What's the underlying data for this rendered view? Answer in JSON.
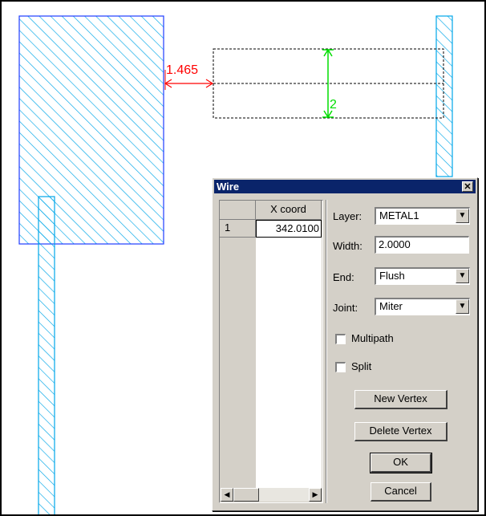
{
  "colors": {
    "shape_hatch": "#00a6e8",
    "shape_edge": "#1e3cff",
    "dimension_red": "#ff0000",
    "dimension_green": "#00dd00",
    "dialog_face": "#d4d0c8",
    "title_active": "#0a246a"
  },
  "canvas": {
    "dimension_horizontal": "1.465",
    "dimension_vertical": "2"
  },
  "dialog": {
    "title": "Wire",
    "close_icon": "close-icon",
    "grid": {
      "column_header": "X coord",
      "rows": [
        {
          "index": "1",
          "x_coord": "342.0100"
        }
      ]
    },
    "layer": {
      "label": "Layer:",
      "value": "METAL1"
    },
    "width": {
      "label": "Width:",
      "value": "2.0000"
    },
    "end": {
      "label": "End:",
      "value": "Flush"
    },
    "joint": {
      "label": "Joint:",
      "value": "Miter"
    },
    "multipath": {
      "label": "Multipath",
      "checked": false
    },
    "split": {
      "label": "Split",
      "checked": false
    },
    "buttons": {
      "new_vertex": "New Vertex",
      "delete_vertex": "Delete Vertex",
      "ok": "OK",
      "cancel": "Cancel"
    }
  }
}
